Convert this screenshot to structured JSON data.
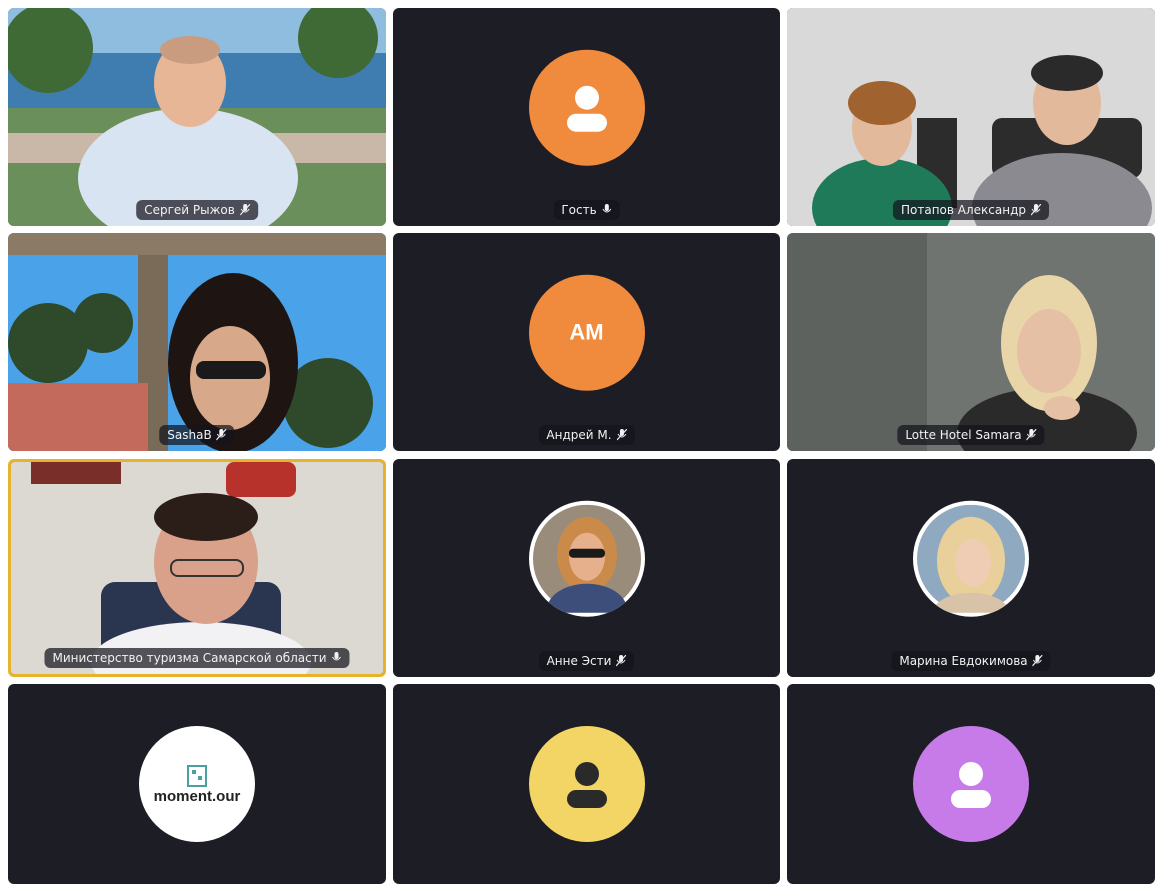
{
  "participants": [
    {
      "name": "Сергей Рыжов",
      "mic": "muted",
      "type": "video"
    },
    {
      "name": "Гость",
      "mic": "on",
      "type": "avatar-icon",
      "color": "#f08a3c"
    },
    {
      "name": "Потапов Александр",
      "mic": "muted",
      "type": "video"
    },
    {
      "name": "SashaB",
      "mic": "muted",
      "type": "video"
    },
    {
      "name": "Андрей М.",
      "mic": "muted",
      "type": "avatar-initials",
      "initials": "AM",
      "color": "#f08a3c"
    },
    {
      "name": "Lotte Hotel Samara",
      "mic": "muted",
      "type": "video"
    },
    {
      "name": "Министерство туризма Самарской области",
      "mic": "on",
      "type": "video",
      "active": true
    },
    {
      "name": "Анне Эсти",
      "mic": "muted",
      "type": "avatar-photo"
    },
    {
      "name": "Марина Евдокимова",
      "mic": "muted",
      "type": "avatar-photo"
    },
    {
      "name": "",
      "mic": "muted",
      "type": "avatar-logo",
      "logo_text": "moment.our"
    },
    {
      "name": "",
      "mic": "muted",
      "type": "avatar-icon",
      "color": "#f2d564"
    },
    {
      "name": "",
      "mic": "muted",
      "type": "avatar-icon",
      "color": "#c77be8"
    }
  ],
  "colors": {
    "tile_bg": "#1d1d26",
    "active_border": "#e6b32a",
    "nametag_bg": "rgba(20,20,28,0.72)"
  }
}
